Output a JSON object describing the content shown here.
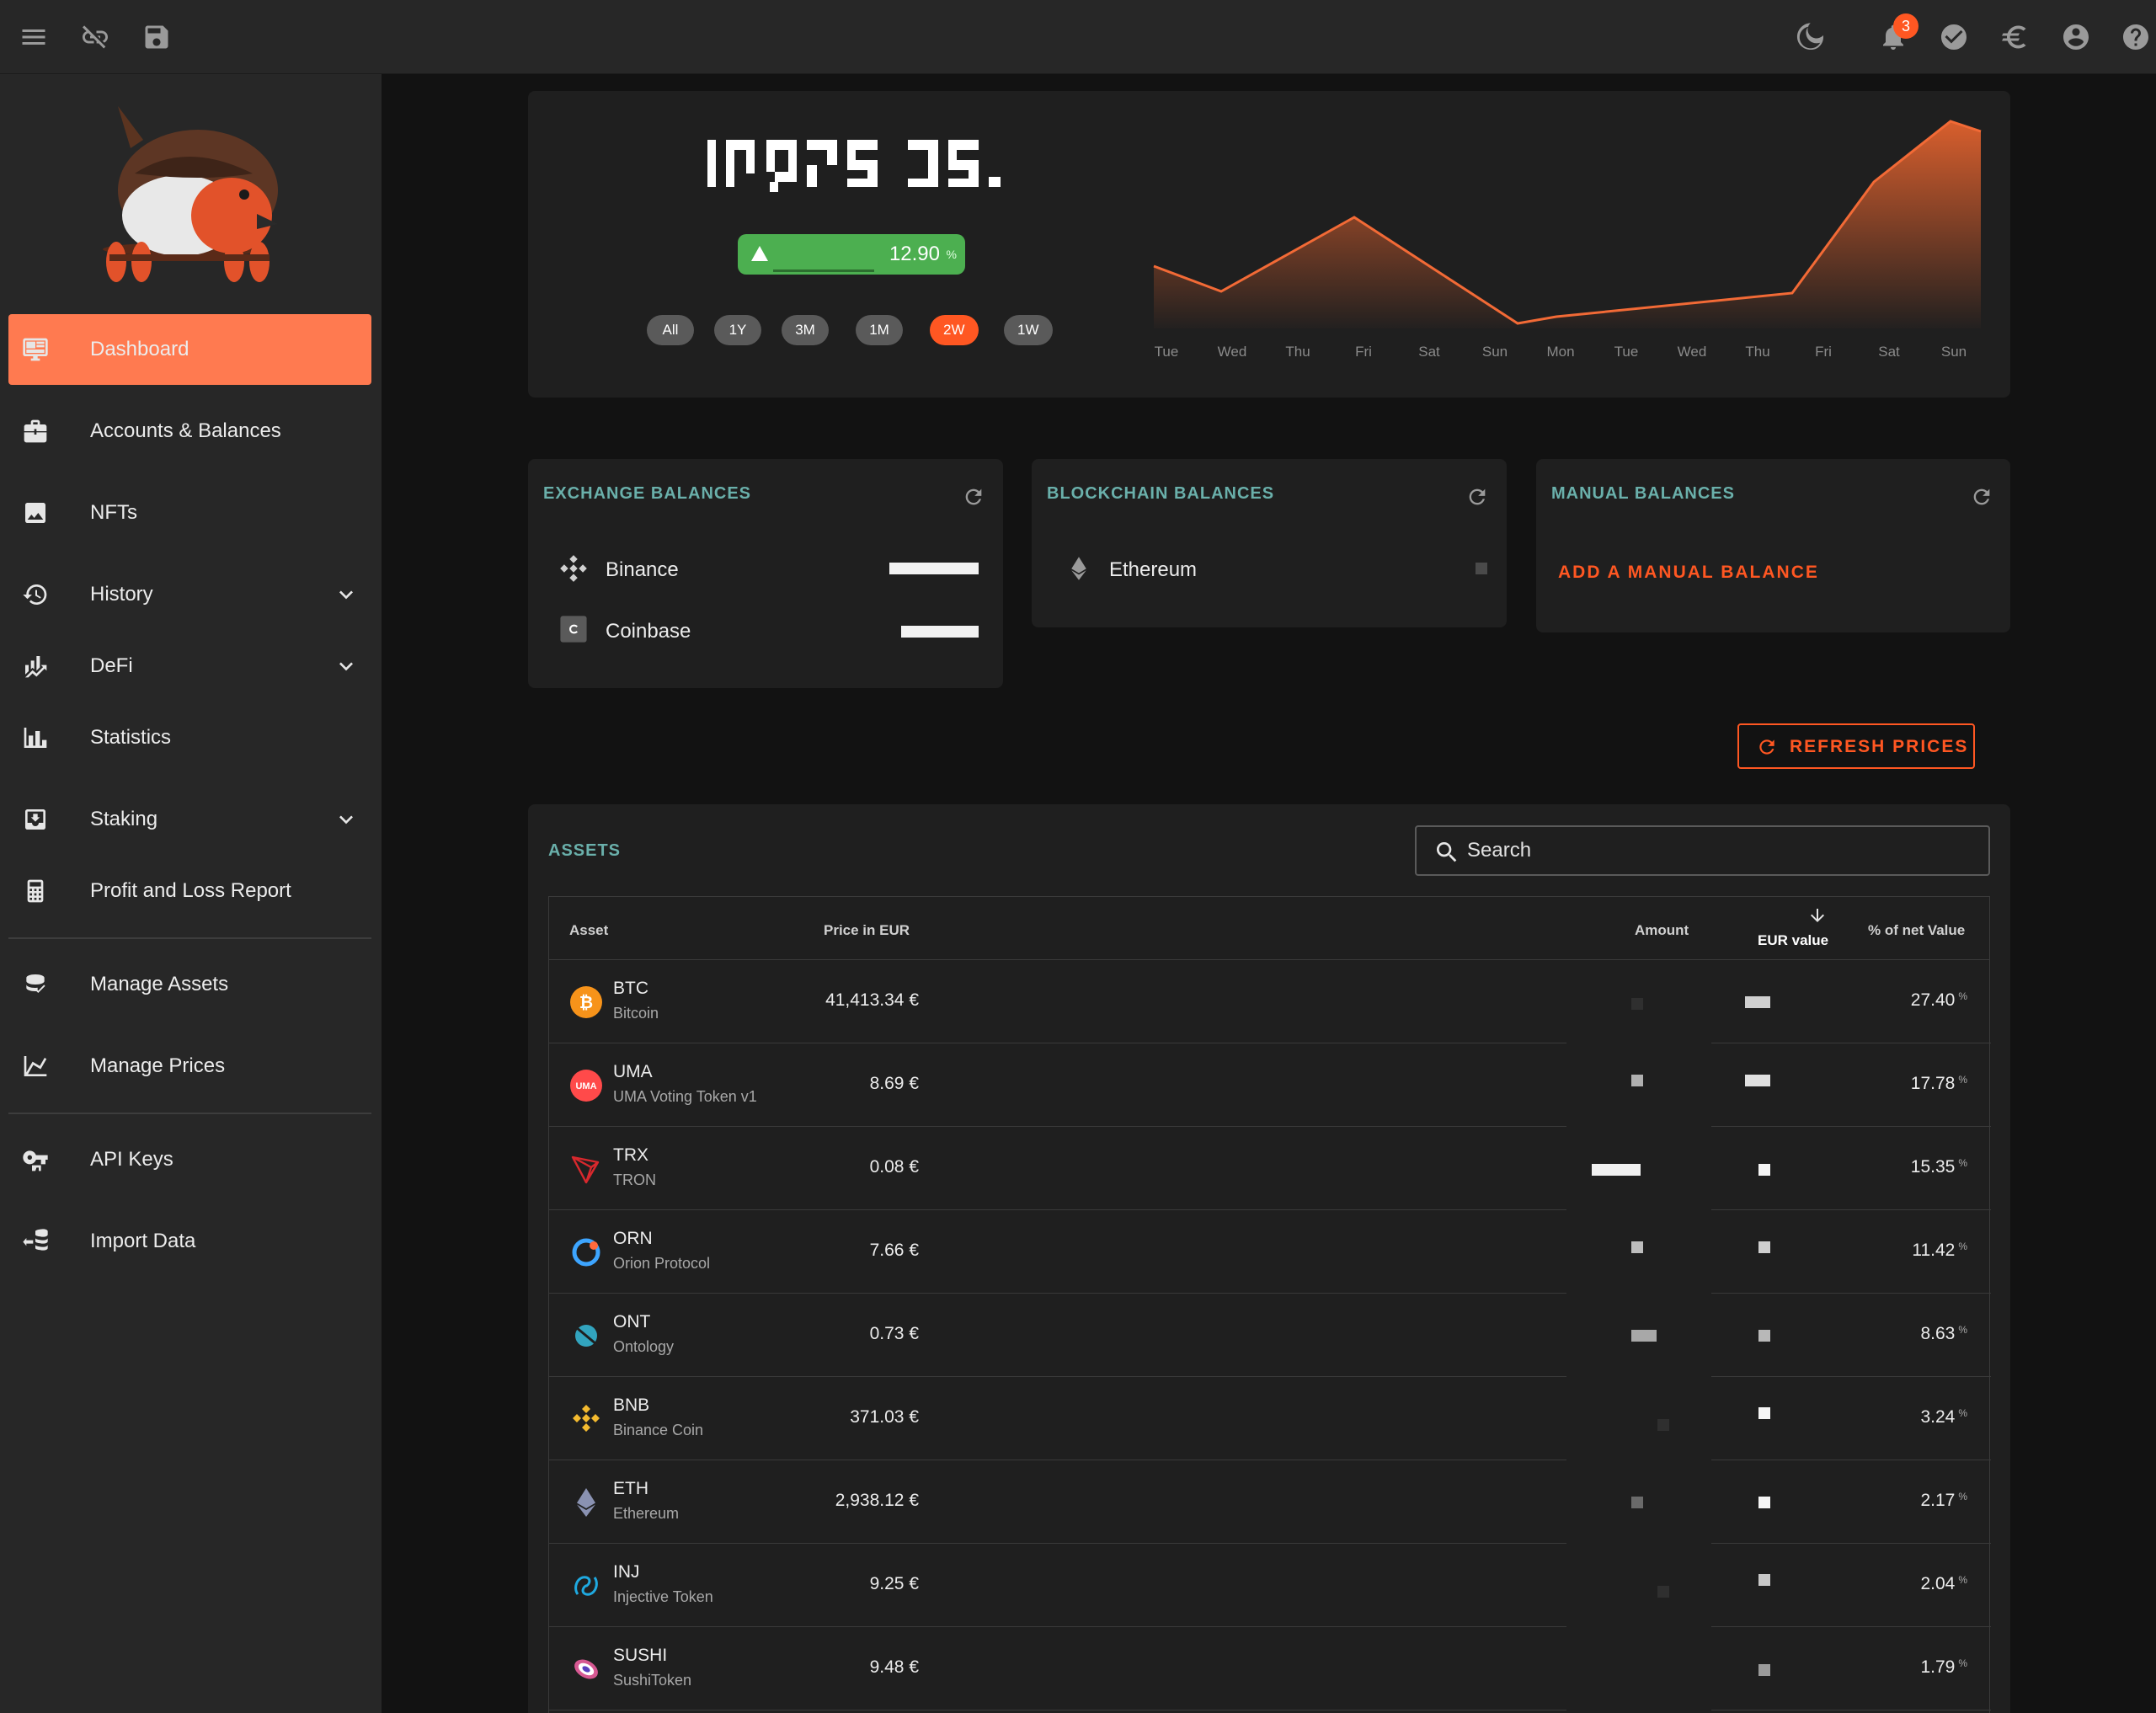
{
  "topbar": {
    "left_icons": [
      "menu-icon",
      "link-off-icon",
      "save-icon"
    ],
    "right_icons": [
      "theme-moon-icon",
      "notification-bell-icon",
      "check-circle-icon",
      "euro-icon",
      "account-icon",
      "help-icon"
    ],
    "notification_count": "3"
  },
  "sidebar": {
    "items": [
      {
        "label": "Dashboard",
        "icon": "monitor-dashboard-icon",
        "active": true
      },
      {
        "label": "Accounts & Balances",
        "icon": "briefcase-icon"
      },
      {
        "label": "NFTs",
        "icon": "image-icon"
      },
      {
        "label": "History",
        "icon": "history-icon",
        "expandable": true
      },
      {
        "label": "DeFi",
        "icon": "finance-chart-icon",
        "expandable": true
      },
      {
        "label": "Statistics",
        "icon": "bar-chart-icon"
      },
      {
        "label": "Staking",
        "icon": "inbox-download-icon",
        "expandable": true
      },
      {
        "label": "Profit and Loss Report",
        "icon": "calculator-icon"
      },
      {
        "label": "Manage Assets",
        "icon": "coins-icon"
      },
      {
        "label": "Manage Prices",
        "icon": "line-chart-icon"
      },
      {
        "label": "API Keys",
        "icon": "key-hand-icon"
      },
      {
        "label": "Import Data",
        "icon": "database-import-icon"
      }
    ]
  },
  "overview": {
    "change_percent": "12.90",
    "percent_symbol": "%",
    "timeframes": [
      "All",
      "1Y",
      "3M",
      "1M",
      "2W",
      "1W"
    ],
    "active_timeframe": "2W",
    "chart_days": [
      "Tue",
      "Wed",
      "Thu",
      "Fri",
      "Sat",
      "Sun",
      "Mon",
      "Tue",
      "Wed",
      "Thu",
      "Fri",
      "Sat",
      "Sun"
    ]
  },
  "balances": {
    "exchange": {
      "title": "EXCHANGE BALANCES",
      "rows": [
        "Binance",
        "Coinbase"
      ]
    },
    "blockchain": {
      "title": "BLOCKCHAIN BALANCES",
      "rows": [
        "Ethereum"
      ]
    },
    "manual": {
      "title": "MANUAL BALANCES",
      "action": "ADD A MANUAL BALANCE"
    }
  },
  "refresh_prices_label": "REFRESH PRICES",
  "assets": {
    "title": "ASSETS",
    "search_placeholder": "Search",
    "columns": {
      "asset": "Asset",
      "price": "Price in EUR",
      "amount": "Amount",
      "value": "EUR value",
      "pct": "% of net Value"
    },
    "rows": [
      {
        "symbol": "BTC",
        "name": "Bitcoin",
        "price": "41,413.34 €",
        "pct": "27.40"
      },
      {
        "symbol": "UMA",
        "name": "UMA Voting Token v1",
        "price": "8.69 €",
        "pct": "17.78"
      },
      {
        "symbol": "TRX",
        "name": "TRON",
        "price": "0.08 €",
        "pct": "15.35"
      },
      {
        "symbol": "ORN",
        "name": "Orion Protocol",
        "price": "7.66 €",
        "pct": "11.42"
      },
      {
        "symbol": "ONT",
        "name": "Ontology",
        "price": "0.73 €",
        "pct": "8.63"
      },
      {
        "symbol": "BNB",
        "name": "Binance Coin",
        "price": "371.03 €",
        "pct": "3.24"
      },
      {
        "symbol": "ETH",
        "name": "Ethereum",
        "price": "2,938.12 €",
        "pct": "2.17"
      },
      {
        "symbol": "INJ",
        "name": "Injective Token",
        "price": "9.25 €",
        "pct": "2.04"
      },
      {
        "symbol": "SUSHI",
        "name": "SushiToken",
        "price": "9.48 €",
        "pct": "1.79"
      }
    ]
  },
  "colors": {
    "accent": "#ff5722",
    "teal_title": "#6ab0ab",
    "positive": "#4caf50"
  }
}
